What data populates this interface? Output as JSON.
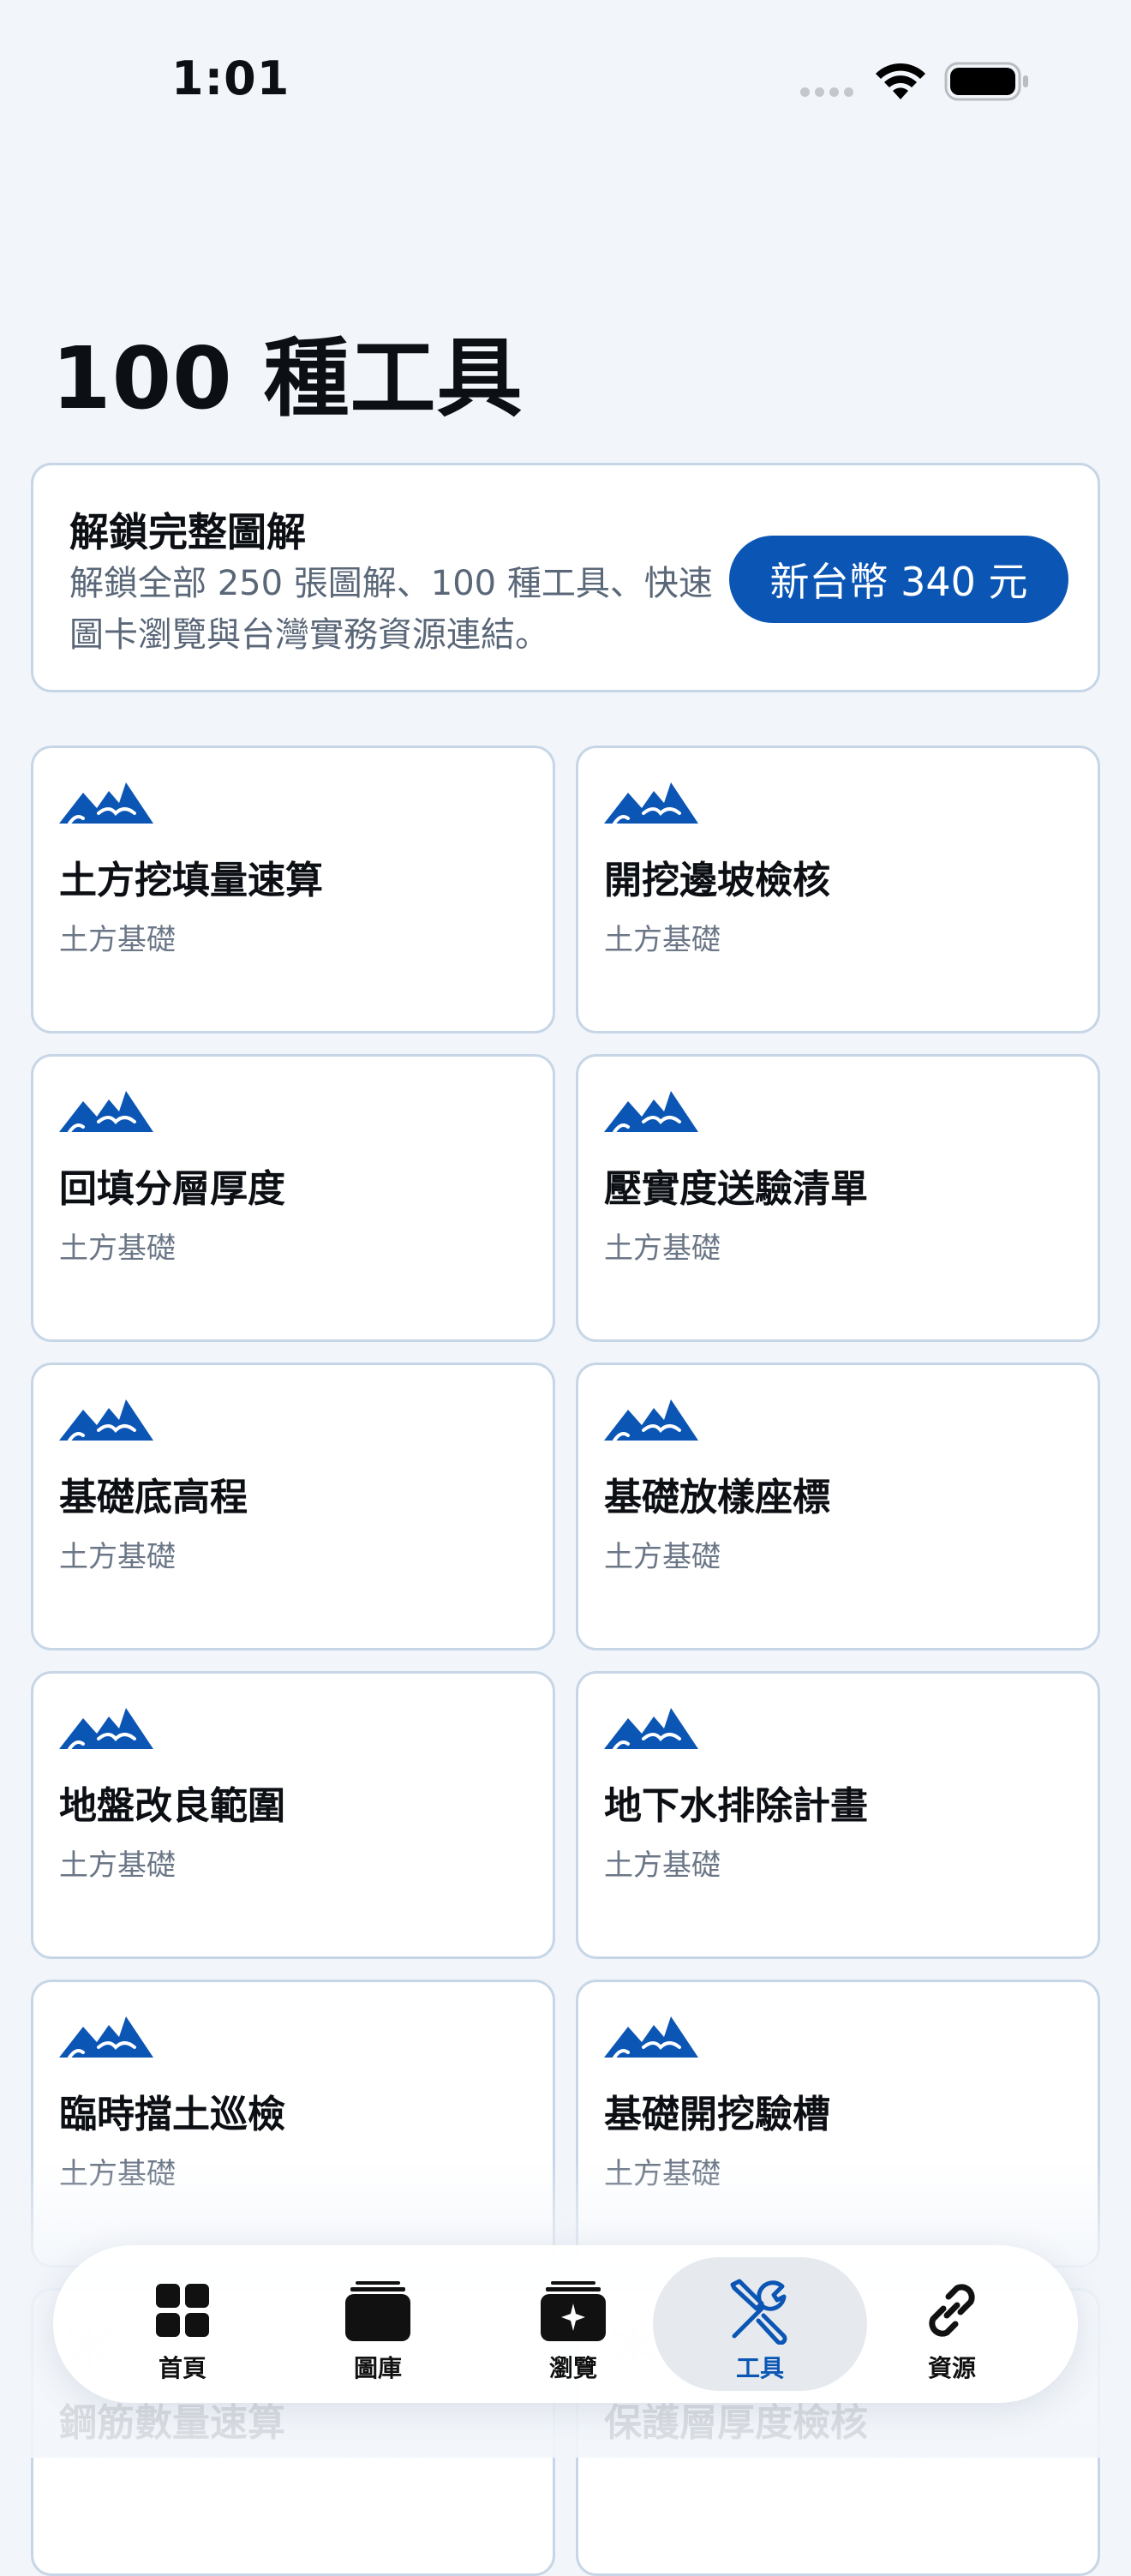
{
  "status_bar": {
    "time": "1:01"
  },
  "page_title": "100 種工具",
  "unlock": {
    "title": "解鎖完整圖解",
    "description": "解鎖全部 250 張圖解、100 種工具、快速圖卡瀏覽與台灣實務資源連結。",
    "button_label": "新台幣 340 元"
  },
  "colors": {
    "accent": "#0b56b5",
    "background": "#f2f6fb",
    "card_border": "#c7d6e6"
  },
  "tools": [
    {
      "name": "土方挖填量速算",
      "category": "土方基礎",
      "icon": "mountain-icon"
    },
    {
      "name": "開挖邊坡檢核",
      "category": "土方基礎",
      "icon": "mountain-icon"
    },
    {
      "name": "回填分層厚度",
      "category": "土方基礎",
      "icon": "mountain-icon"
    },
    {
      "name": "壓實度送驗清單",
      "category": "土方基礎",
      "icon": "mountain-icon"
    },
    {
      "name": "基礎底高程",
      "category": "土方基礎",
      "icon": "mountain-icon"
    },
    {
      "name": "基礎放樣座標",
      "category": "土方基礎",
      "icon": "mountain-icon"
    },
    {
      "name": "地盤改良範圍",
      "category": "土方基礎",
      "icon": "mountain-icon"
    },
    {
      "name": "地下水排除計畫",
      "category": "土方基礎",
      "icon": "mountain-icon"
    },
    {
      "name": "臨時擋土巡檢",
      "category": "土方基礎",
      "icon": "mountain-icon"
    },
    {
      "name": "基礎開挖驗槽",
      "category": "土方基礎",
      "icon": "mountain-icon"
    },
    {
      "name": "鋼筋數量速算",
      "category": "",
      "icon": "rebar-icon"
    },
    {
      "name": "保護層厚度檢核",
      "category": "",
      "icon": "rebar-icon"
    }
  ],
  "tab_bar": {
    "items": [
      {
        "label": "首頁",
        "icon": "grid-icon"
      },
      {
        "label": "圖庫",
        "icon": "stack-icon"
      },
      {
        "label": "瀏覽",
        "icon": "sparkle-stack-icon"
      },
      {
        "label": "工具",
        "icon": "tools-icon",
        "active": true
      },
      {
        "label": "資源",
        "icon": "link-icon"
      }
    ]
  }
}
